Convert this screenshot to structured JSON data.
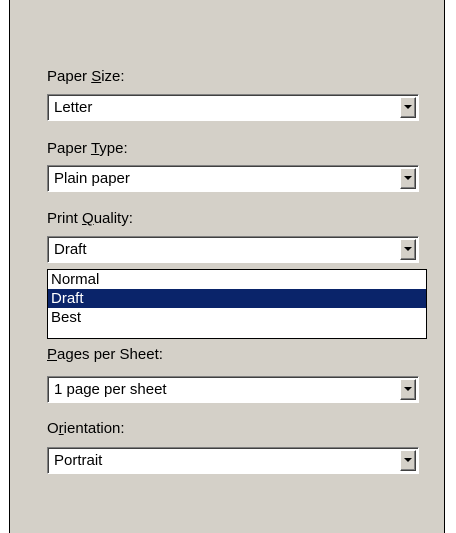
{
  "paper_size": {
    "label_pre": "Paper ",
    "label_mnemonic": "S",
    "label_post": "ize:",
    "value": "Letter",
    "icon": "chevron-down-icon"
  },
  "paper_type": {
    "label_pre": "Paper ",
    "label_mnemonic": "T",
    "label_post": "ype:",
    "value": "Plain paper",
    "icon": "chevron-down-icon"
  },
  "print_quality": {
    "label_pre": "Print ",
    "label_mnemonic": "Q",
    "label_post": "uality:",
    "value": "Draft",
    "options": [
      "Normal",
      "Draft",
      "Best"
    ],
    "selected_index": 1,
    "icon": "chevron-down-icon"
  },
  "pages_per_sheet": {
    "label_pre": "",
    "label_mnemonic": "P",
    "label_post": "ages per Sheet:",
    "value": "1 page per sheet",
    "icon": "chevron-down-icon"
  },
  "orientation": {
    "label_pre": "O",
    "label_mnemonic": "r",
    "label_post": "ientation:",
    "value": "Portrait",
    "icon": "chevron-down-icon"
  },
  "colors": {
    "panel_bg": "#d4d0c8",
    "selection_bg": "#0a246a",
    "selection_text": "#ffffff"
  }
}
